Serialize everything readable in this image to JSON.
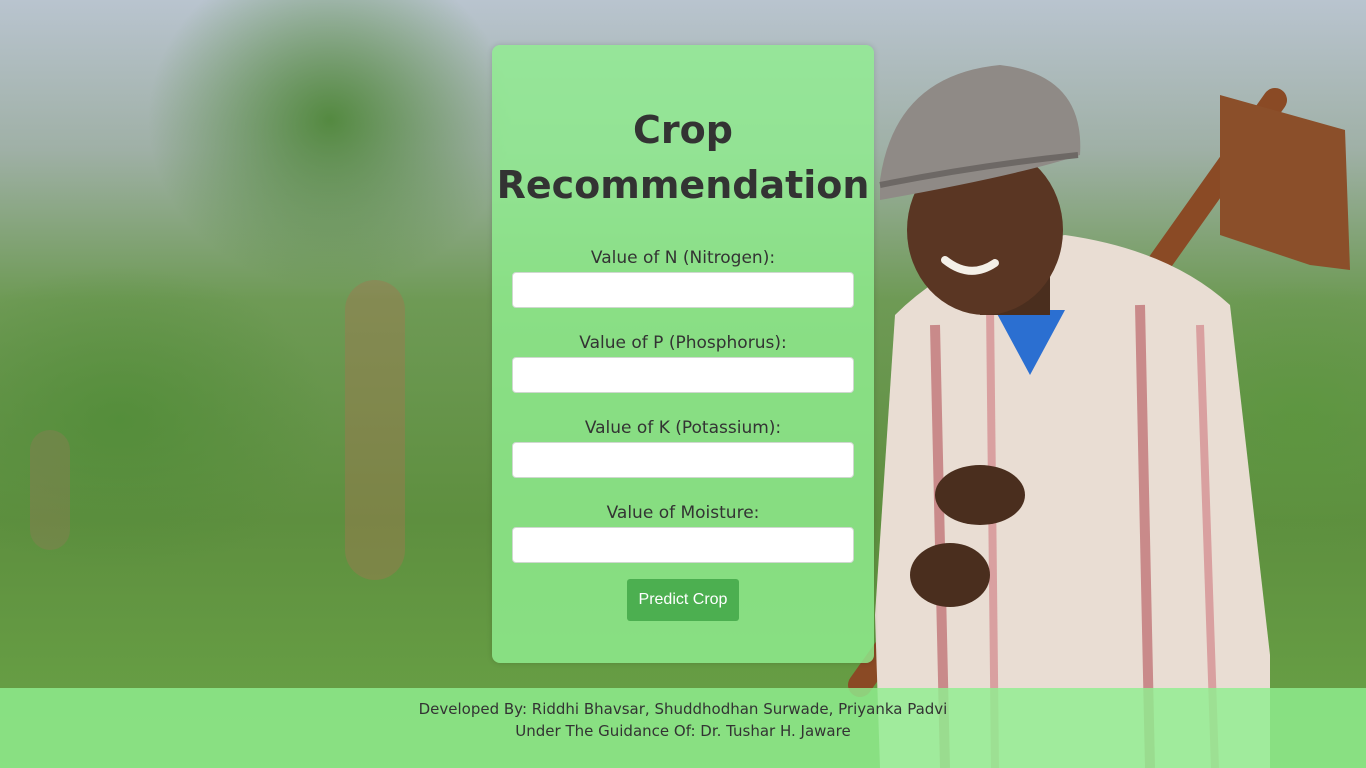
{
  "form": {
    "title": "Crop Recommendation",
    "fields": [
      {
        "label": "Value of N (Nitrogen):",
        "value": ""
      },
      {
        "label": "Value of P (Phosphorus):",
        "value": ""
      },
      {
        "label": "Value of K (Potassium):",
        "value": ""
      },
      {
        "label": "Value of Moisture:",
        "value": ""
      }
    ],
    "submit_label": "Predict Crop"
  },
  "footer": {
    "developers": "Developed By: Riddhi Bhavsar, Shuddhodhan Surwade, Priyanka Padvi",
    "guidance": "Under The Guidance Of: Dr. Tushar H. Jaware"
  },
  "colors": {
    "card_background": "#90ee90",
    "button": "#4caf50",
    "text": "#333333"
  },
  "icons": [
    "farmer-photo-background"
  ]
}
